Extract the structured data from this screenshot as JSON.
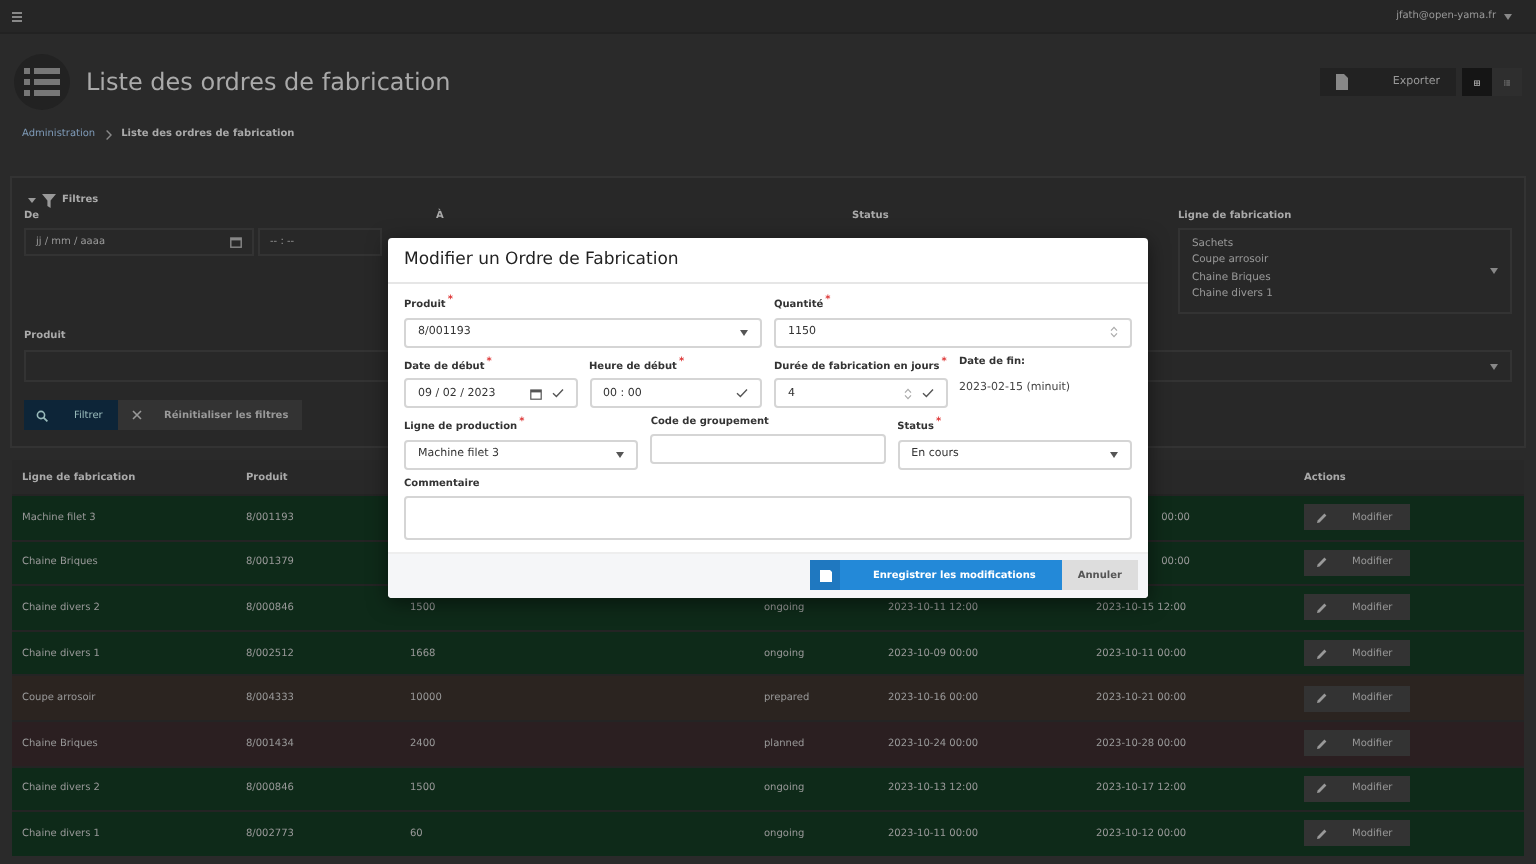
{
  "topbar": {
    "user": "jfath@open-yama.fr"
  },
  "header": {
    "title": "Liste des ordres de fabrication",
    "export_label": "Exporter",
    "views": [
      {
        "kind": "grid",
        "selected": true
      },
      {
        "kind": "list",
        "selected": false
      }
    ]
  },
  "breadcrumb": [
    {
      "label": "Administration",
      "kind": "link"
    },
    {
      "label": "Liste des ordres de fabrication",
      "kind": "current"
    }
  ],
  "filters": {
    "title": "Filtres",
    "expanded": true,
    "from_label": "De",
    "from_date_placeholder": "jj / mm / aaaa",
    "from_time_placeholder": "-- : --",
    "to_label": "À",
    "status_label": "Status",
    "line_label": "Ligne de fabrication",
    "line_options": [
      "Sachets",
      "Coupe arrosoir",
      "Chaine Briques",
      "Chaine divers 1"
    ],
    "product_label": "Produit",
    "filter_button": "Filtrer",
    "reset_button": "Réinitialiser les filtres"
  },
  "table": {
    "columns": [
      {
        "label": "Ligne de fabrication"
      },
      {
        "label": "Produit"
      },
      {
        "label": "Actions"
      }
    ],
    "rows": [
      {
        "color": "#0e2a19",
        "line": "Machine filet 3",
        "product": "8/001193",
        "end": "00:00",
        "action": "Modifier"
      },
      {
        "color": "#0e2a19",
        "line": "Chaine Briques",
        "product": "8/001379",
        "end": "00:00",
        "action": "Modifier"
      },
      {
        "color": "#0e2a19",
        "line": "Chaine divers 2",
        "product": "8/000846",
        "quantity": "1500",
        "status": "ongoing",
        "start": "2023-10-11 12:00",
        "end": "2023-10-15 12:00",
        "action": "Modifier"
      },
      {
        "color": "#0e2a19",
        "line": "Chaine divers 1",
        "product": "8/002512",
        "quantity": "1668",
        "status": "ongoing",
        "start": "2023-10-09 00:00",
        "end": "2023-10-11 00:00",
        "action": "Modifier"
      },
      {
        "color": "#2b2420",
        "line": "Coupe arrosoir",
        "product": "8/004333",
        "quantity": "10000",
        "status": "prepared",
        "start": "2023-10-16 00:00",
        "end": "2023-10-21 00:00",
        "action": "Modifier"
      },
      {
        "color": "#2b1f21",
        "line": "Chaine Briques",
        "product": "8/001434",
        "quantity": "2400",
        "status": "planned",
        "start": "2023-10-24 00:00",
        "end": "2023-10-28 00:00",
        "action": "Modifier"
      },
      {
        "color": "#0e2a19",
        "line": "Chaine divers 2",
        "product": "8/000846",
        "quantity": "1500",
        "status": "ongoing",
        "start": "2023-10-13 12:00",
        "end": "2023-10-17 12:00",
        "action": "Modifier"
      },
      {
        "color": "#0e2a19",
        "line": "Chaine divers 1",
        "product": "8/002773",
        "quantity": "60",
        "status": "ongoing",
        "start": "2023-10-11 00:00",
        "end": "2023-10-12 00:00",
        "action": "Modifier"
      }
    ]
  },
  "modal": {
    "title": "Modifier un Ordre de Fabrication",
    "required_mark": "*",
    "product": {
      "label": "Produit",
      "required": true,
      "value": "8/001193"
    },
    "quantity": {
      "label": "Quantité",
      "required": true,
      "value": "1150"
    },
    "start_date": {
      "label": "Date de début",
      "required": true,
      "value": "09 / 02 / 2023",
      "valid": true
    },
    "start_time": {
      "label": "Heure de début",
      "required": true,
      "value": "00 : 00",
      "valid": true
    },
    "duration": {
      "label": "Durée de fabrication en jours",
      "required": true,
      "value": "4",
      "valid": true
    },
    "end_date": {
      "label": "Date de fin:",
      "value": "2023-02-15 (minuit)"
    },
    "line": {
      "label": "Ligne de production",
      "required": true,
      "value": "Machine filet 3"
    },
    "group_code": {
      "label": "Code de groupement",
      "required": false
    },
    "status": {
      "label": "Status",
      "required": true,
      "value": "En cours"
    },
    "comment": {
      "label": "Commentaire"
    },
    "save_button": "Enregistrer les modifications",
    "cancel_button": "Annuler"
  }
}
